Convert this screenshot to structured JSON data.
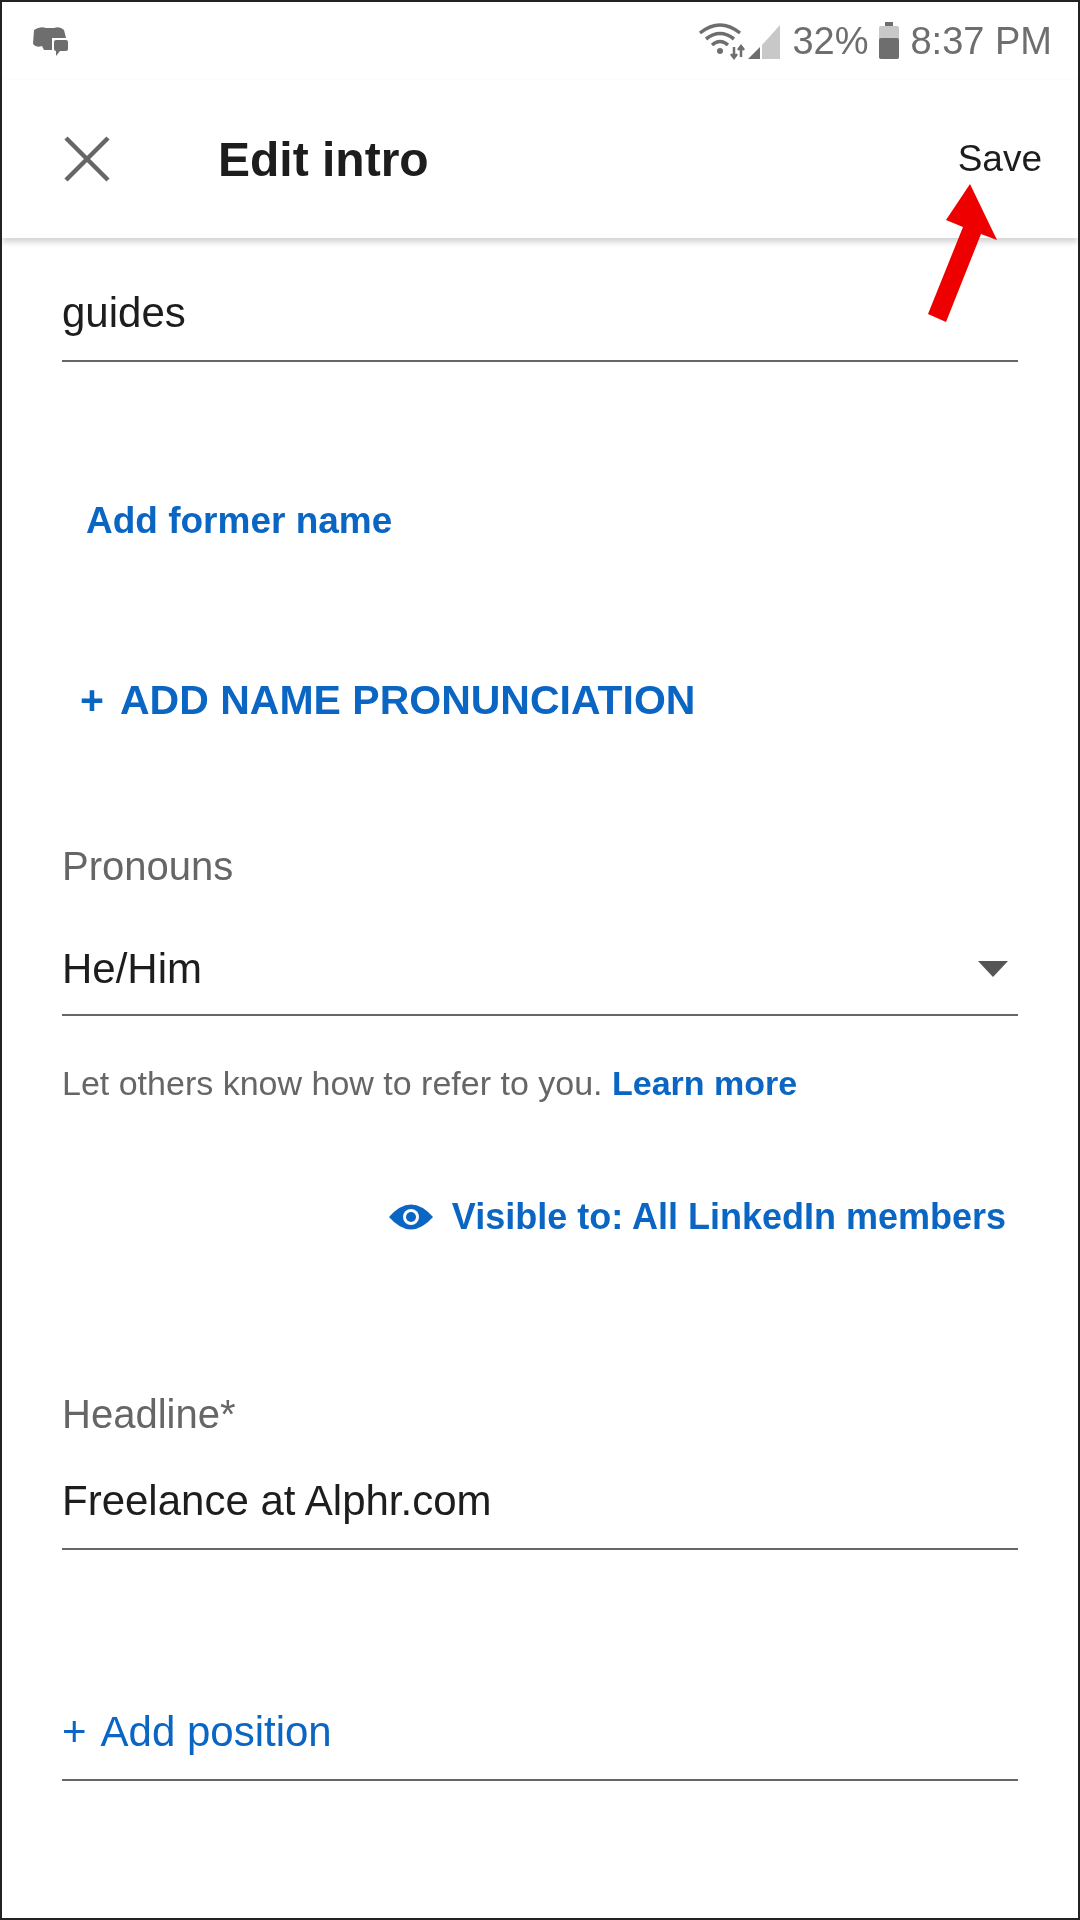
{
  "status_bar": {
    "battery": "32%",
    "time": "8:37 PM"
  },
  "app_bar": {
    "title": "Edit intro",
    "save": "Save"
  },
  "name_field": {
    "value": "guides"
  },
  "add_former_name": "Add former name",
  "add_pronunciation": {
    "icon": "+",
    "label": "ADD NAME PRONUNCIATION"
  },
  "pronouns": {
    "label": "Pronouns",
    "value": "He/Him",
    "helper": "Let others know how to refer to you.",
    "link": "Learn more"
  },
  "visibility": "Visible to: All LinkedIn members",
  "headline": {
    "label": "Headline*",
    "value": "Freelance at Alphr.com"
  },
  "add_position": {
    "icon": "+",
    "label": "Add position"
  }
}
